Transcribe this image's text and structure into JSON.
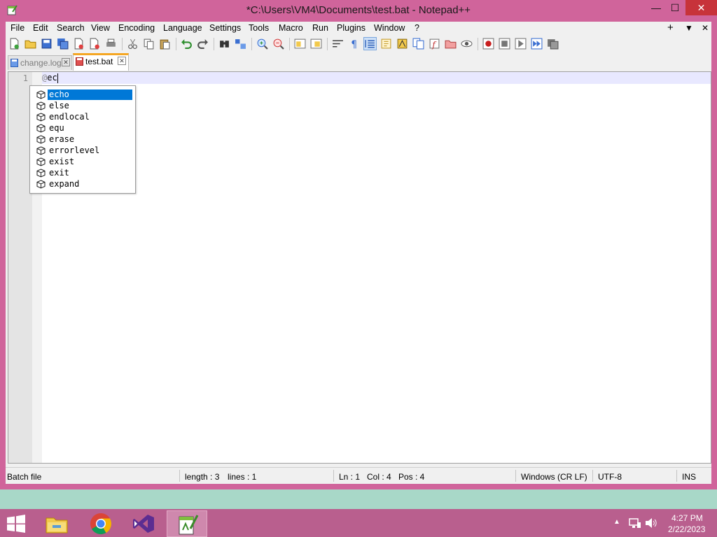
{
  "window": {
    "title": "*C:\\Users\\VM4\\Documents\\test.bat - Notepad++",
    "controls": {
      "minimize": "—",
      "maximize": "☐",
      "close": "✕"
    }
  },
  "menu": {
    "items": [
      "File",
      "Edit",
      "Search",
      "View",
      "Encoding",
      "Language",
      "Settings",
      "Tools",
      "Macro",
      "Run",
      "Plugins",
      "Window",
      "?"
    ],
    "right": {
      "add": "+",
      "dropdown": "▼",
      "close": "✕"
    }
  },
  "tabs": [
    {
      "label": "change.log",
      "close": "✕"
    },
    {
      "label": "test.bat",
      "close": "✕"
    }
  ],
  "editor": {
    "line_number": "1",
    "code_prefix": "@",
    "code_rest": "ec"
  },
  "autocomplete": {
    "items": [
      "echo",
      "else",
      "endlocal",
      "equ",
      "erase",
      "errorlevel",
      "exist",
      "exit",
      "expand"
    ],
    "selected_index": 0
  },
  "status": {
    "file_type": "Batch file",
    "length": "length : 3",
    "lines": "lines : 1",
    "ln": "Ln : 1",
    "col": "Col : 4",
    "pos": "Pos : 4",
    "eol": "Windows (CR LF)",
    "encoding": "UTF-8",
    "mode": "INS"
  },
  "taskbar": {
    "time": "4:27 PM",
    "date": "2/22/2023"
  },
  "colors": {
    "frame": "#d0649b",
    "taskbar": "#b95f8e",
    "close_button": "#c7333a",
    "selection": "#0078d7",
    "active_tab_accent": "#f5a623"
  }
}
